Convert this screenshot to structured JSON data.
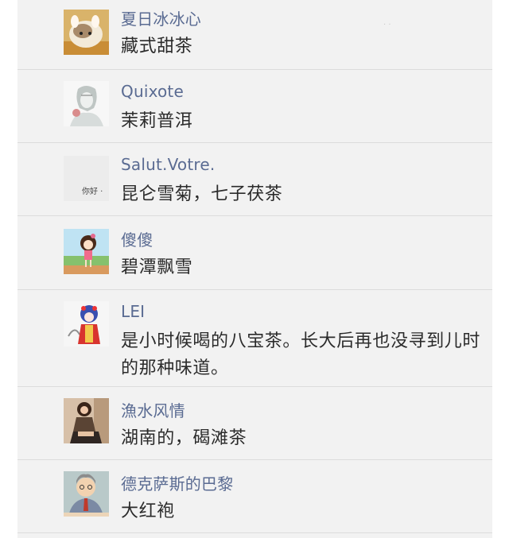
{
  "comments": [
    {
      "name": "夏日冰冰心",
      "text": "藏式甜茶",
      "avatar_icon": "hamster-photo-icon"
    },
    {
      "name": "Quixote",
      "text": "茉莉普洱",
      "avatar_icon": "sketch-portrait-icon"
    },
    {
      "name": "Salut.Votre.",
      "text": "昆仑雪菊，七子茯茶",
      "avatar_icon": "text-avatar-icon",
      "avatar_text": "你好 ·"
    },
    {
      "name": "傻傻",
      "text": "碧潭飘雪",
      "avatar_icon": "cartoon-girl-icon"
    },
    {
      "name": "LEI",
      "text": "是小时候喝的八宝茶。长大后再也没寻到儿时的那种味道。",
      "avatar_icon": "opera-figure-icon"
    },
    {
      "name": "漁水风情",
      "text": "湖南的，碣滩茶",
      "avatar_icon": "girl-photo-icon"
    },
    {
      "name": "德克萨斯的巴黎",
      "text": "大红袍",
      "avatar_icon": "cartoon-man-icon"
    }
  ],
  "colors": {
    "name": "#5a6b92",
    "text": "#2b2b2b",
    "background": "#f2f2f2",
    "divider": "#dcdcdc"
  }
}
